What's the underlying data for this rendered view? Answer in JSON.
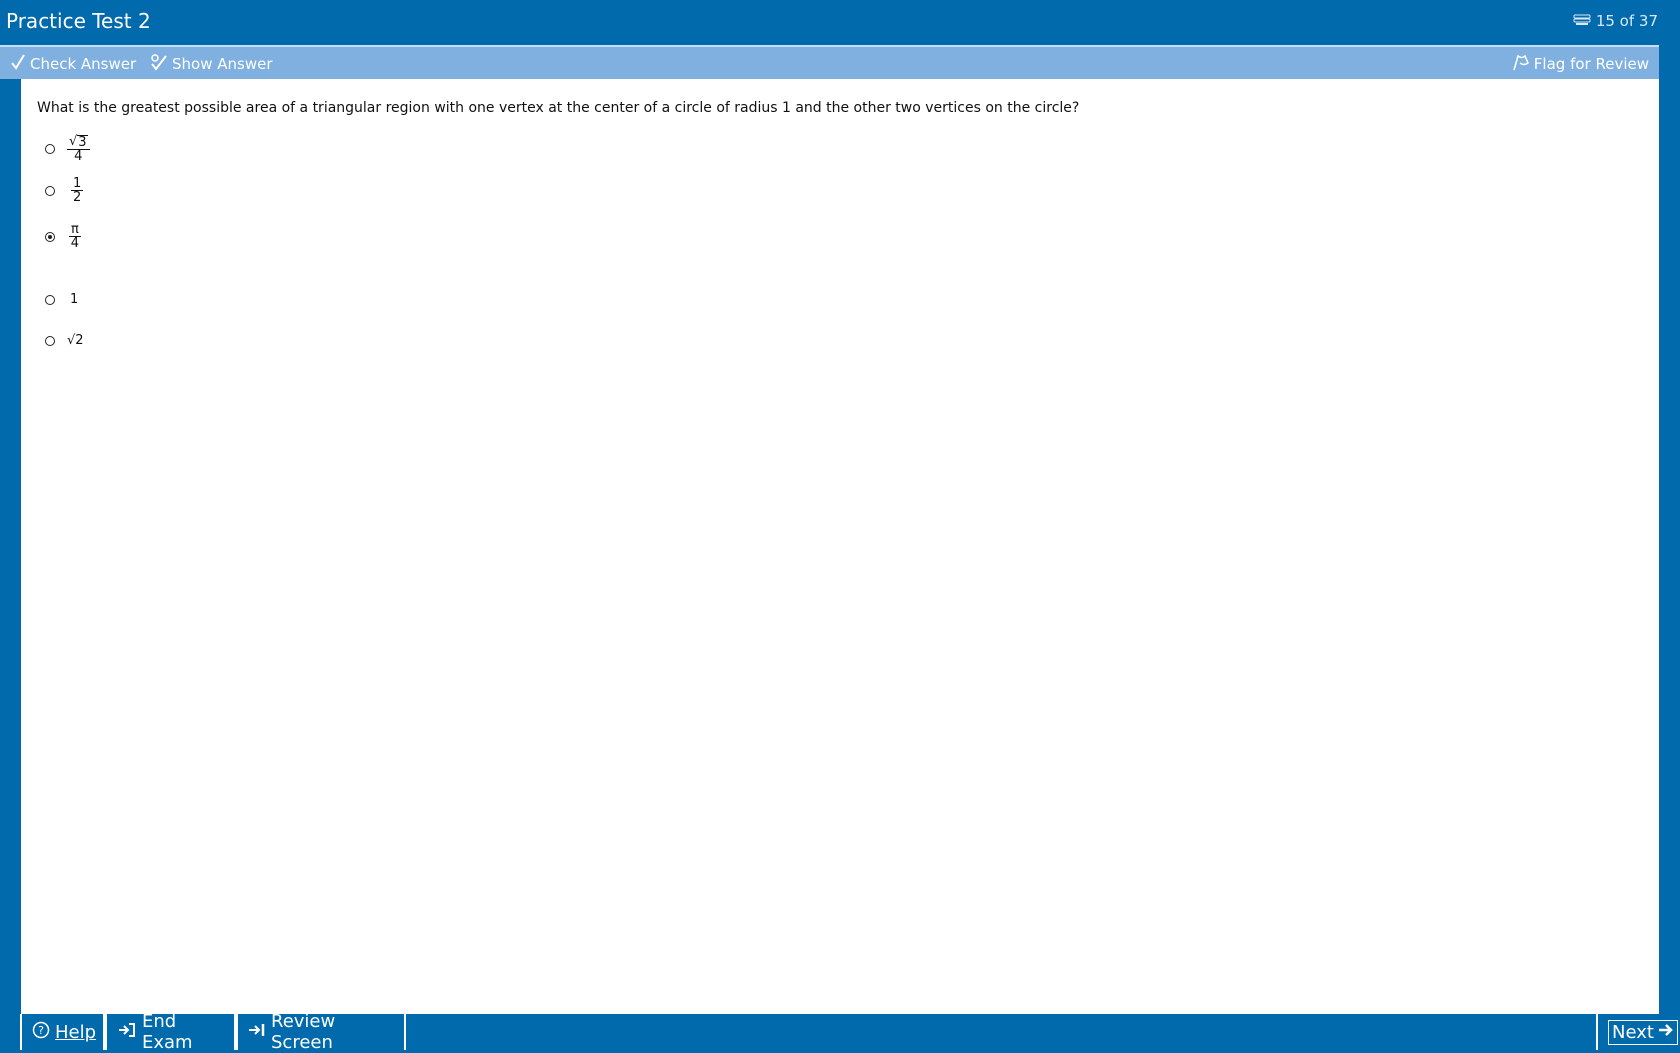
{
  "titlebar": {
    "title": "Practice Test 2",
    "counter": "15 of 37"
  },
  "toolbar": {
    "check_answer": "Check Answer",
    "show_answer": "Show Answer",
    "flag_review": "Flag for Review"
  },
  "question": {
    "text": "What is the greatest possible area of a triangular region with one vertex at the center of a circle of radius 1 and the other two vertices on the circle?",
    "choices": [
      {
        "num": "√3",
        "den": "4"
      },
      {
        "num": "1",
        "den": "2"
      },
      {
        "num": "π",
        "den": "4"
      },
      {
        "value": "1"
      },
      {
        "value": "√2"
      }
    ],
    "selected_index": 2
  },
  "bottombar": {
    "help": "Help",
    "end_exam": "End Exam",
    "review_screen": "Review Screen",
    "next": "Next"
  },
  "colors": {
    "frame": "#006aac",
    "toolbar": "#7fb0e0",
    "content": "#ffffff"
  }
}
